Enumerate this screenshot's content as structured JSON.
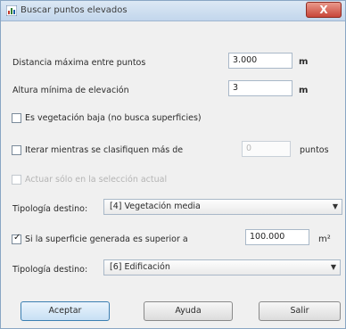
{
  "window": {
    "title": "Buscar puntos elevados",
    "close_label": "X"
  },
  "form": {
    "max_distance": {
      "label": "Distancia máxima entre puntos",
      "value": "3.000",
      "unit": "m"
    },
    "min_height": {
      "label": "Altura mínima de elevación",
      "value": "3",
      "unit": "m"
    },
    "low_vegetation": {
      "label": "Es vegetación baja (no busca superficies)",
      "checked": false
    },
    "iterate": {
      "label_before": "Iterar mientras se clasifiquen más de",
      "value": "0",
      "label_after": "puntos",
      "checked": false
    },
    "selection_only": {
      "label": "Actuar sólo en la selección actual",
      "checked": false,
      "disabled": true
    },
    "target_typology_1": {
      "label": "Tipología destino:",
      "selected": "[4] Vegetación media"
    },
    "surface": {
      "label": "Si la superficie generada es superior a",
      "value": "100.000",
      "unit": "m²",
      "checked": true
    },
    "target_typology_2": {
      "label": "Tipología destino:",
      "selected": "[6] Edificación"
    }
  },
  "buttons": {
    "accept": "Aceptar",
    "help": "Ayuda",
    "exit": "Salir"
  }
}
